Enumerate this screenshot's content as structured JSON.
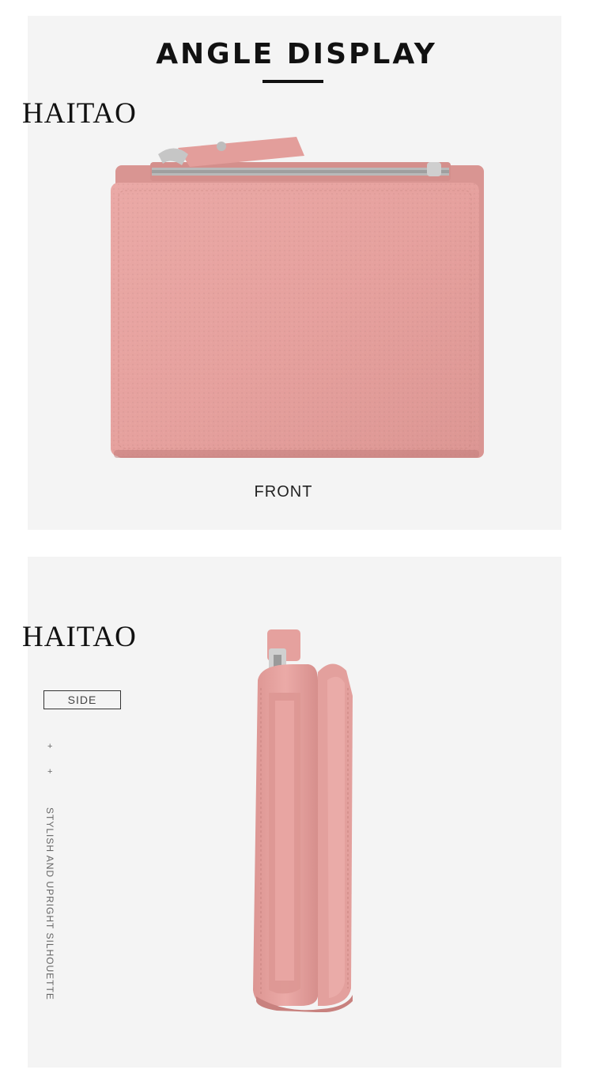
{
  "header": {
    "title": "ANGLE DISPLAY"
  },
  "brand": {
    "name": "HAITAO"
  },
  "front_view": {
    "caption": "FRONT"
  },
  "side_view": {
    "label": "SIDE",
    "markers": [
      "+",
      "+"
    ],
    "tagline": "STYLISH AND UPRIGHT SILHOUETTE"
  },
  "colors": {
    "panel_background": "#f4f4f4",
    "wallet_pink": "#e7a3a0",
    "wallet_pink_dark": "#d58d8a",
    "zipper_silver": "#c9c9c9"
  }
}
